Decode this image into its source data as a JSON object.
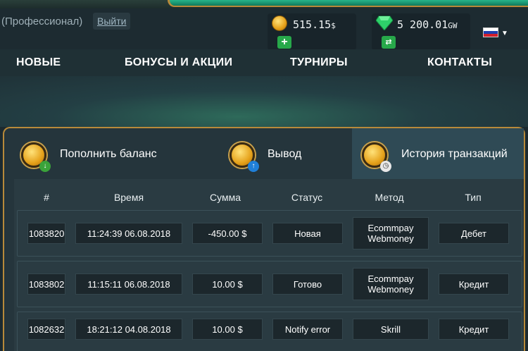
{
  "header": {
    "user_status": "(Профессионал)",
    "logout": "Выйти",
    "gold_balance": "515.15",
    "gold_unit": "$",
    "gem_balance": "5 200.01",
    "gem_unit": "GW",
    "gold_add_icon": "plus-icon",
    "gem_exchange_icon": "shuffle-icon"
  },
  "nav": {
    "items": [
      "НОВЫЕ",
      "БОНУСЫ И АКЦИИ",
      "ТУРНИРЫ",
      "КОНТАКТЫ"
    ]
  },
  "tabs": [
    {
      "label": "Пополнить баланс",
      "badge_icon": "arrow-down-icon"
    },
    {
      "label": "Вывод",
      "badge_icon": "arrow-up-icon"
    },
    {
      "label": "История транзакций",
      "badge_icon": "clock-icon"
    }
  ],
  "table": {
    "headers": [
      "#",
      "Время",
      "Сумма",
      "Статус",
      "Метод",
      "Тип"
    ],
    "rows": [
      {
        "id": "1083820",
        "time": "11:24:39 06.08.2018",
        "amount": "-450.00 $",
        "status": "Новая",
        "method_line1": "Ecommpay",
        "method_line2": "Webmoney",
        "type": "Дебет"
      },
      {
        "id": "1083802",
        "time": "11:15:11 06.08.2018",
        "amount": "10.00 $",
        "status": "Готово",
        "method_line1": "Ecommpay",
        "method_line2": "Webmoney",
        "type": "Кредит"
      },
      {
        "id": "1082632",
        "time": "18:21:12 04.08.2018",
        "amount": "10.00 $",
        "status": "Notify error",
        "method_line1": "Skrill",
        "method_line2": "",
        "type": "Кредит"
      }
    ]
  },
  "colors": {
    "accent_gold": "#b88a3a",
    "active_tab": "#2f4a55",
    "add_button": "#27a84a"
  }
}
